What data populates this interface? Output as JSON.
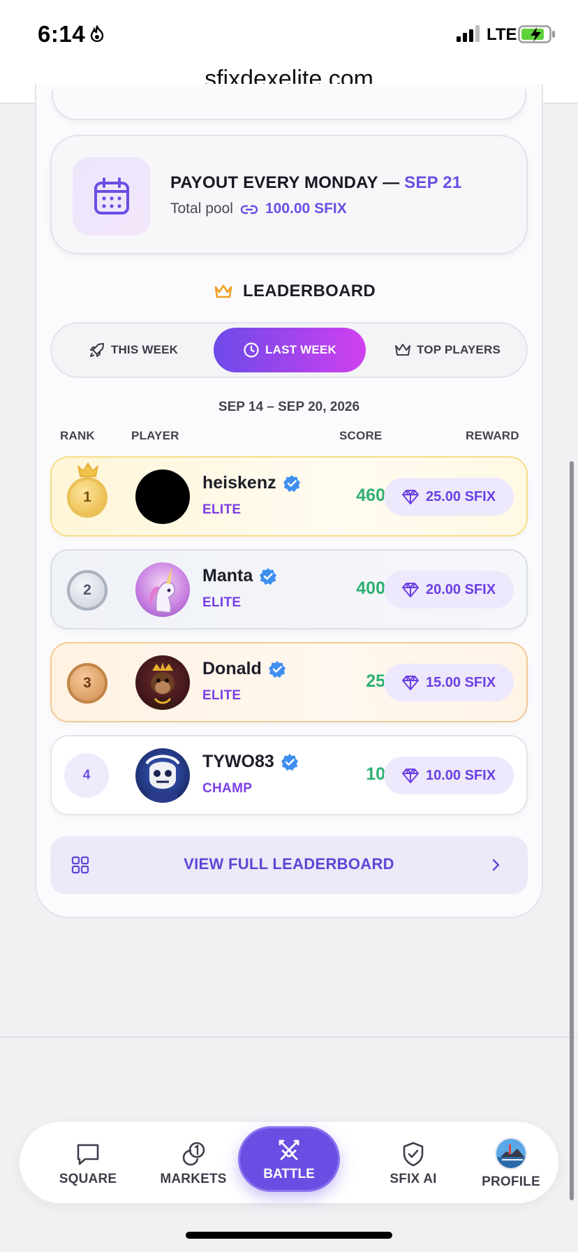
{
  "status": {
    "time": "6:14",
    "network": "LTE",
    "battery_color": "#5fd13b"
  },
  "browser": {
    "url": "sfixdexelite.com"
  },
  "payout": {
    "title_prefix": "PAYOUT EVERY MONDAY — ",
    "date": "SEP 21",
    "pool_label": "Total pool",
    "pool_value": "100.00 SFIX"
  },
  "leaderboard": {
    "heading": "LEADERBOARD",
    "tabs": [
      {
        "label": "THIS WEEK",
        "icon": "rocket-icon",
        "active": false
      },
      {
        "label": "LAST WEEK",
        "icon": "clock-icon",
        "active": true
      },
      {
        "label": "TOP PLAYERS",
        "icon": "crown-icon",
        "active": false
      }
    ],
    "date_range": "SEP 14 – SEP 20, 2026",
    "columns": {
      "rank": "RANK",
      "player": "PLAYER",
      "score": "SCORE",
      "reward": "REWARD"
    },
    "rows": [
      {
        "rank": "1",
        "name": "heiskenz",
        "tier": "ELITE",
        "score": "460",
        "reward": "25.00 SFIX",
        "verified": true
      },
      {
        "rank": "2",
        "name": "Manta",
        "tier": "ELITE",
        "score": "400",
        "reward": "20.00 SFIX",
        "verified": true
      },
      {
        "rank": "3",
        "name": "Donald",
        "tier": "ELITE",
        "score": "25",
        "reward": "15.00 SFIX",
        "verified": true
      },
      {
        "rank": "4",
        "name": "TYWO83",
        "tier": "CHAMP",
        "score": "10",
        "reward": "10.00 SFIX",
        "verified": true
      }
    ],
    "view_full": "VIEW FULL LEADERBOARD"
  },
  "nav": {
    "square": "SQUARE",
    "markets": "MARKETS",
    "battle": "BATTLE",
    "sfix_ai": "SFIX AI",
    "profile": "PROFILE"
  },
  "colors": {
    "accent": "#6a4ee3",
    "score_green": "#2fb071",
    "tier_purple": "#7a3ee6"
  }
}
